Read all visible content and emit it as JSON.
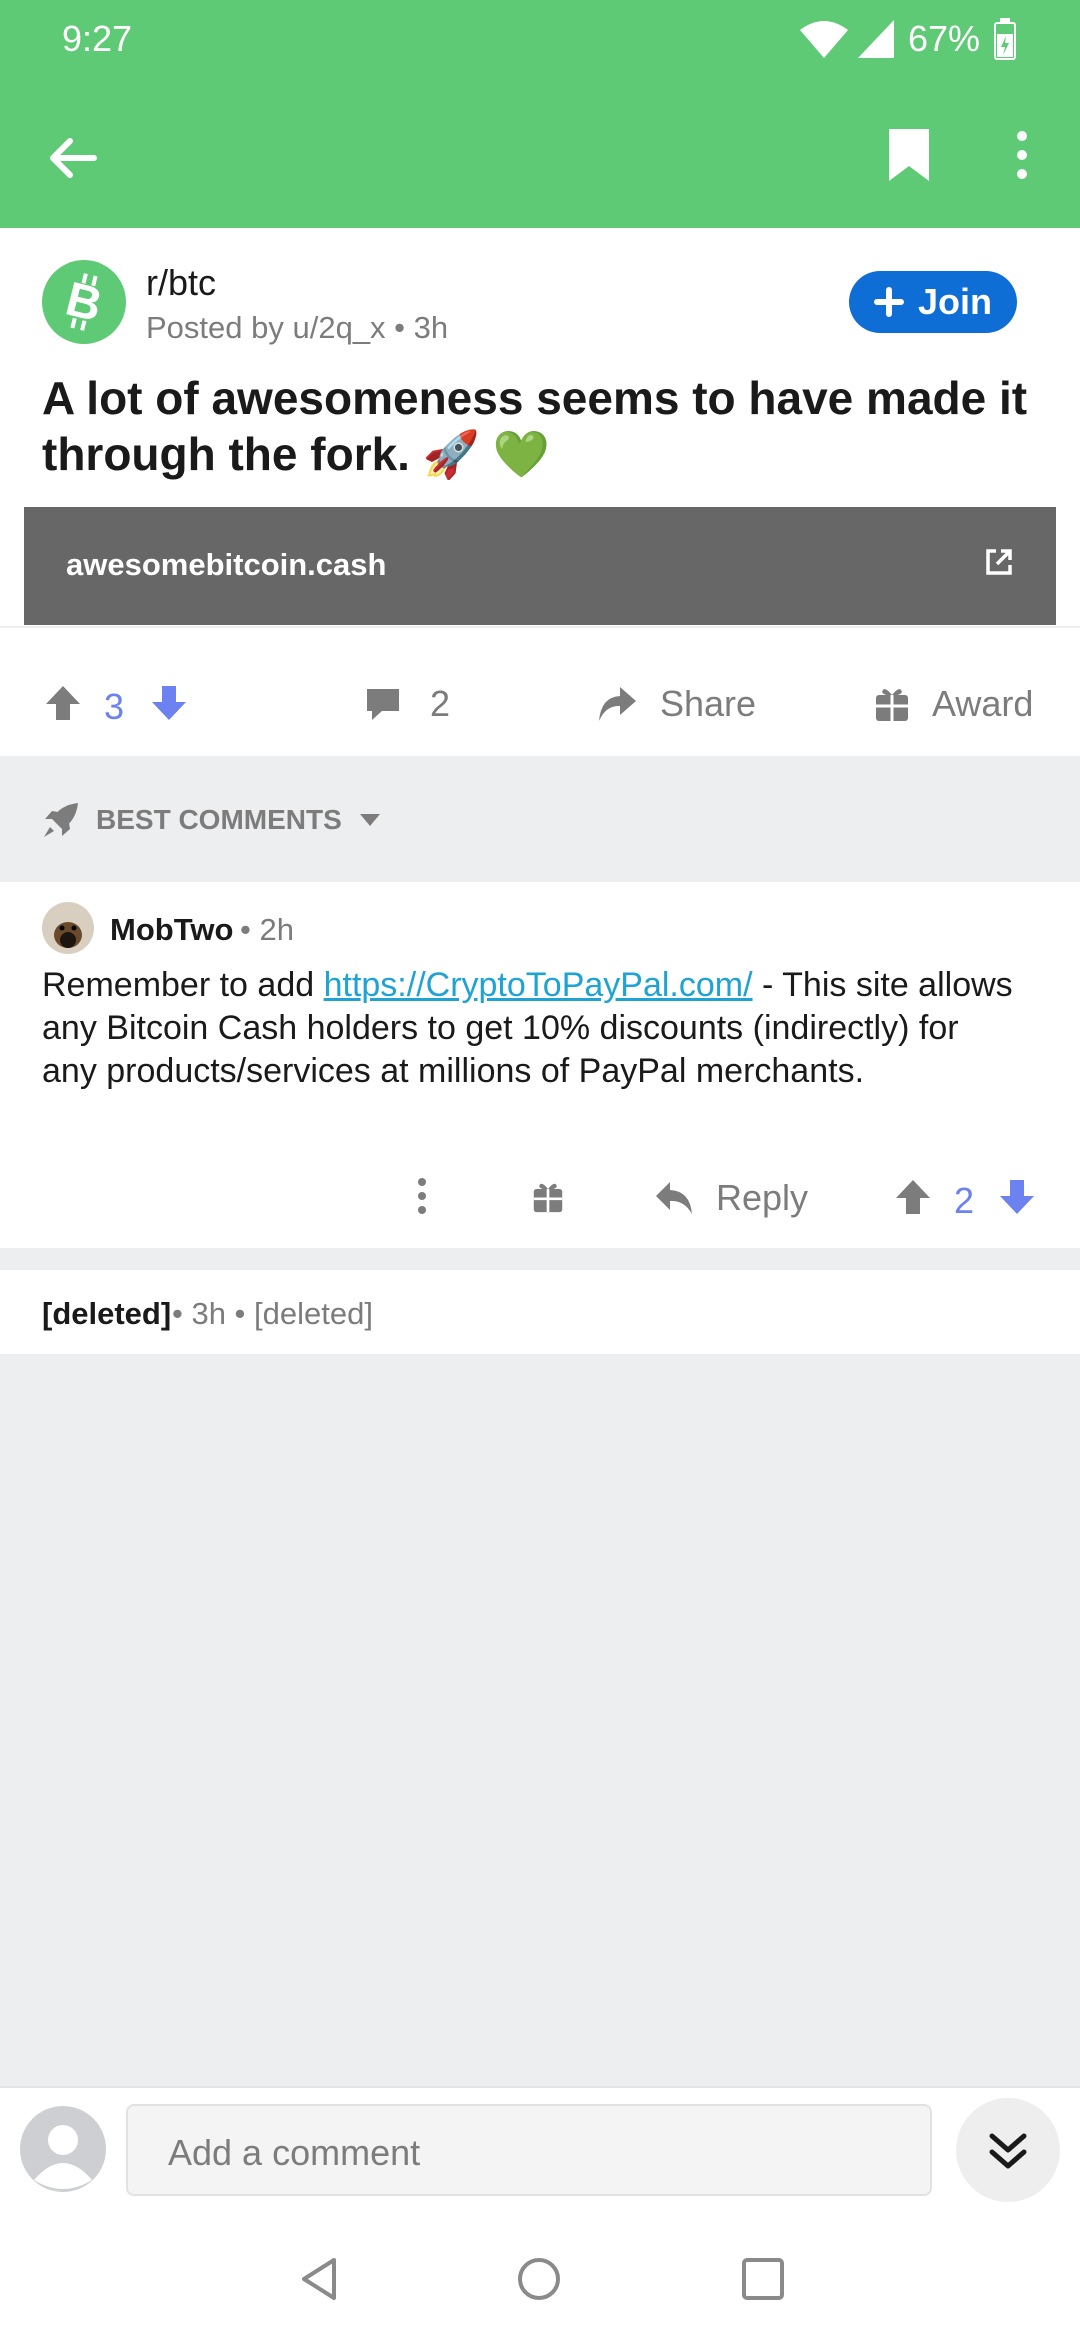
{
  "status_bar": {
    "time": "9:27",
    "battery": "67%"
  },
  "colors": {
    "header_green": "#5fca75",
    "join_blue": "#0f6dd6",
    "vote_blue": "#6b82f0",
    "link_blue": "#1ea3d4"
  },
  "toolbar": {
    "back_icon": "arrow-left-icon",
    "bookmark_icon": "bookmark-icon",
    "more_icon": "more-vertical-icon"
  },
  "post": {
    "subreddit": "r/btc",
    "meta": "Posted by u/2q_x • 3h",
    "join_label": "Join",
    "title": "A lot of awesomeness seems to have made it through the fork. 🚀 💚",
    "link_domain": "awesomebitcoin.cash",
    "votes": "3",
    "comments": "2",
    "share_label": "Share",
    "award_label": "Award"
  },
  "sort": {
    "label": "BEST COMMENTS"
  },
  "comments": [
    {
      "author": "MobTwo",
      "time": "• 2h",
      "text_before": "Remember to add ",
      "link": "https://CryptoToPayPal.com/",
      "text_after": " - This site allows any Bitcoin Cash holders to get 10% discounts (indirectly) for any products/services at millions of PayPal merchants.",
      "reply_label": "Reply",
      "votes": "2"
    },
    {
      "author": "[deleted]",
      "meta": "• 3h • [deleted]"
    }
  ],
  "composer": {
    "placeholder": "Add a comment"
  }
}
